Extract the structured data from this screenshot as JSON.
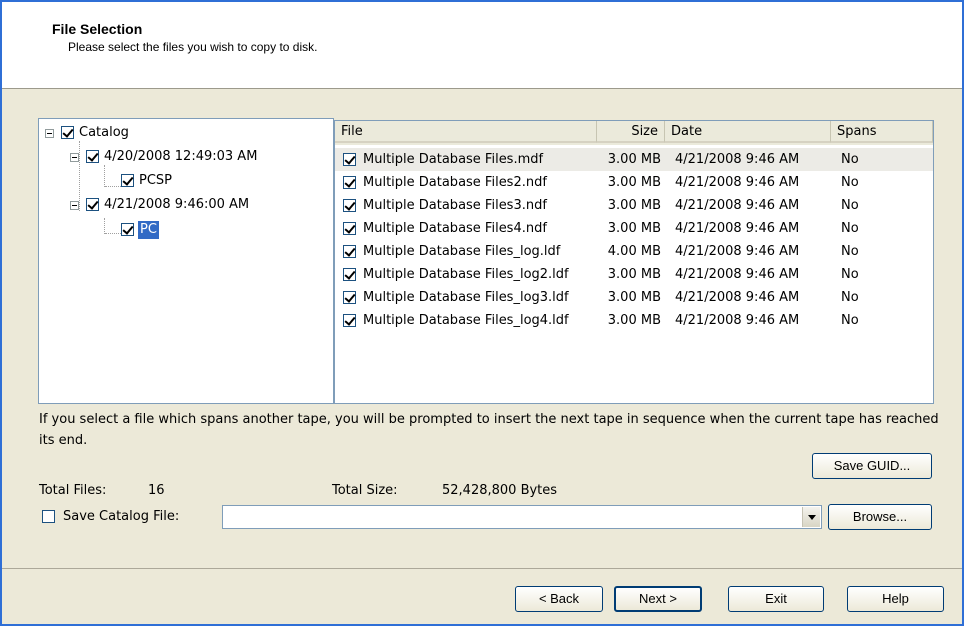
{
  "header": {
    "title": "File Selection",
    "subtitle": "Please select the files you wish to copy to disk."
  },
  "tree": {
    "root": {
      "label": "Catalog",
      "checked": true
    },
    "sessions": [
      {
        "label": "4/20/2008 12:49:03 AM",
        "checked": true,
        "child": {
          "label": "PCSP",
          "checked": true,
          "selected": false
        }
      },
      {
        "label": "4/21/2008 9:46:00 AM",
        "checked": true,
        "child": {
          "label": "PC",
          "checked": true,
          "selected": true
        }
      }
    ]
  },
  "list": {
    "columns": [
      "File",
      "Size",
      "Date",
      "Spans"
    ],
    "rows": [
      {
        "file": "Multiple Database Files.mdf",
        "size": "3.00 MB",
        "date": "4/21/2008 9:46 AM",
        "spans": "No",
        "checked": true
      },
      {
        "file": "Multiple Database Files2.ndf",
        "size": "3.00 MB",
        "date": "4/21/2008 9:46 AM",
        "spans": "No",
        "checked": true
      },
      {
        "file": "Multiple Database Files3.ndf",
        "size": "3.00 MB",
        "date": "4/21/2008 9:46 AM",
        "spans": "No",
        "checked": true
      },
      {
        "file": "Multiple Database Files4.ndf",
        "size": "3.00 MB",
        "date": "4/21/2008 9:46 AM",
        "spans": "No",
        "checked": true
      },
      {
        "file": "Multiple Database Files_log.ldf",
        "size": "4.00 MB",
        "date": "4/21/2008 9:46 AM",
        "spans": "No",
        "checked": true
      },
      {
        "file": "Multiple Database Files_log2.ldf",
        "size": "3.00 MB",
        "date": "4/21/2008 9:46 AM",
        "spans": "No",
        "checked": true
      },
      {
        "file": "Multiple Database Files_log3.ldf",
        "size": "3.00 MB",
        "date": "4/21/2008 9:46 AM",
        "spans": "No",
        "checked": true
      },
      {
        "file": "Multiple Database Files_log4.ldf",
        "size": "3.00 MB",
        "date": "4/21/2008 9:46 AM",
        "spans": "No",
        "checked": true
      }
    ]
  },
  "note": "If you select a file which spans another tape, you will be prompted to insert the next tape in sequence when the current tape has reached its end.",
  "totals": {
    "files_label": "Total Files:",
    "files_value": "16",
    "size_label": "Total Size:",
    "size_value": "52,428,800 Bytes"
  },
  "catalog": {
    "save_label": "Save Catalog File:",
    "save_checked": false,
    "path_value": ""
  },
  "buttons": {
    "save_guid": "Save GUID...",
    "browse": "Browse...",
    "back": "< Back",
    "next": "Next >",
    "exit": "Exit",
    "help": "Help"
  }
}
